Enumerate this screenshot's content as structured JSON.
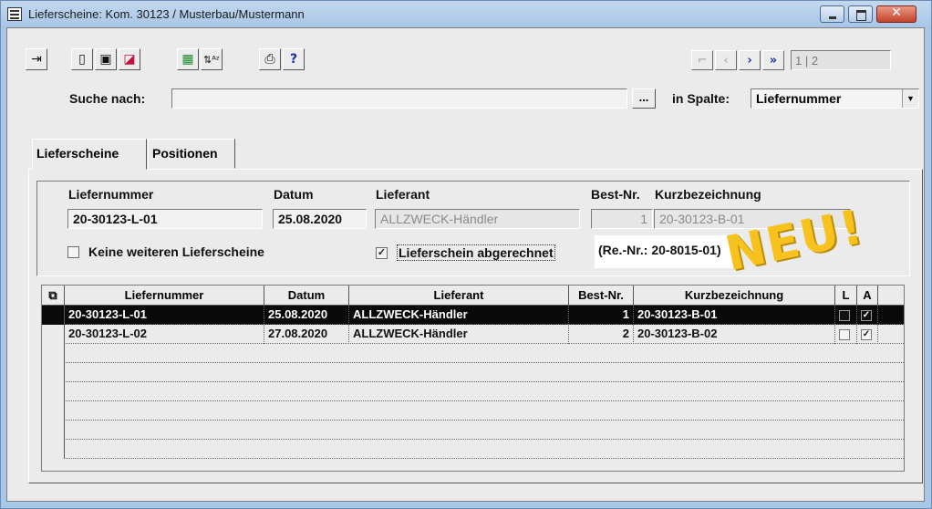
{
  "window": {
    "title": "Lieferscheine: Kom. 30123 / Musterbau/Mustermann"
  },
  "toolbar": {
    "buttons": [
      "exit-icon",
      "new-document-icon",
      "save-icon",
      "edit-icon",
      "export-icon",
      "sort-az-icon",
      "print-icon",
      "help-icon"
    ],
    "help_label": "?"
  },
  "navigation": {
    "pager": "1 | 2"
  },
  "search": {
    "label": "Suche nach:",
    "value": "",
    "more_button": "...",
    "column_label": "in Spalte:",
    "column_value": "Liefernummer"
  },
  "tabs": [
    "Lieferscheine",
    "Positionen"
  ],
  "form": {
    "liefernummer_label": "Liefernummer",
    "liefernummer_value": "20-30123-L-01",
    "datum_label": "Datum",
    "datum_value": "25.08.2020",
    "lieferant_label": "Lieferant",
    "lieferant_value": "ALLZWECK-Händler",
    "bestnr_label": "Best-Nr.",
    "bestnr_value": "1",
    "kurz_label": "Kurzbezeichnung",
    "kurz_value": "20-30123-B-01",
    "cb_keine_label": "Keine weiteren Lieferscheine",
    "cb_keine_checked": false,
    "cb_abgerechnet_label": "Lieferschein abgerechnet",
    "cb_abgerechnet_checked": true,
    "rechnung_note": "(Re.-Nr.: 20-8015-01)"
  },
  "badge": "NEU!",
  "table": {
    "columns": [
      "Liefernummer",
      "Datum",
      "Lieferant",
      "Best-Nr.",
      "Kurzbezeichnung",
      "L",
      "A"
    ],
    "rows": [
      {
        "liefernummer": "20-30123-L-01",
        "datum": "25.08.2020",
        "lieferant": "ALLZWECK-Händler",
        "bestnr": "1",
        "kurz": "20-30123-B-01",
        "l": false,
        "a": true,
        "selected": true
      },
      {
        "liefernummer": "20-30123-L-02",
        "datum": "27.08.2020",
        "lieferant": "ALLZWECK-Händler",
        "bestnr": "2",
        "kurz": "20-30123-B-02",
        "l": false,
        "a": true,
        "selected": false
      }
    ]
  },
  "colors": {
    "title_bar": "#a9c7e8",
    "selection": "#0a0a0a",
    "badge": "#f7c21d",
    "nav_arrow": "#1c2fb0"
  }
}
